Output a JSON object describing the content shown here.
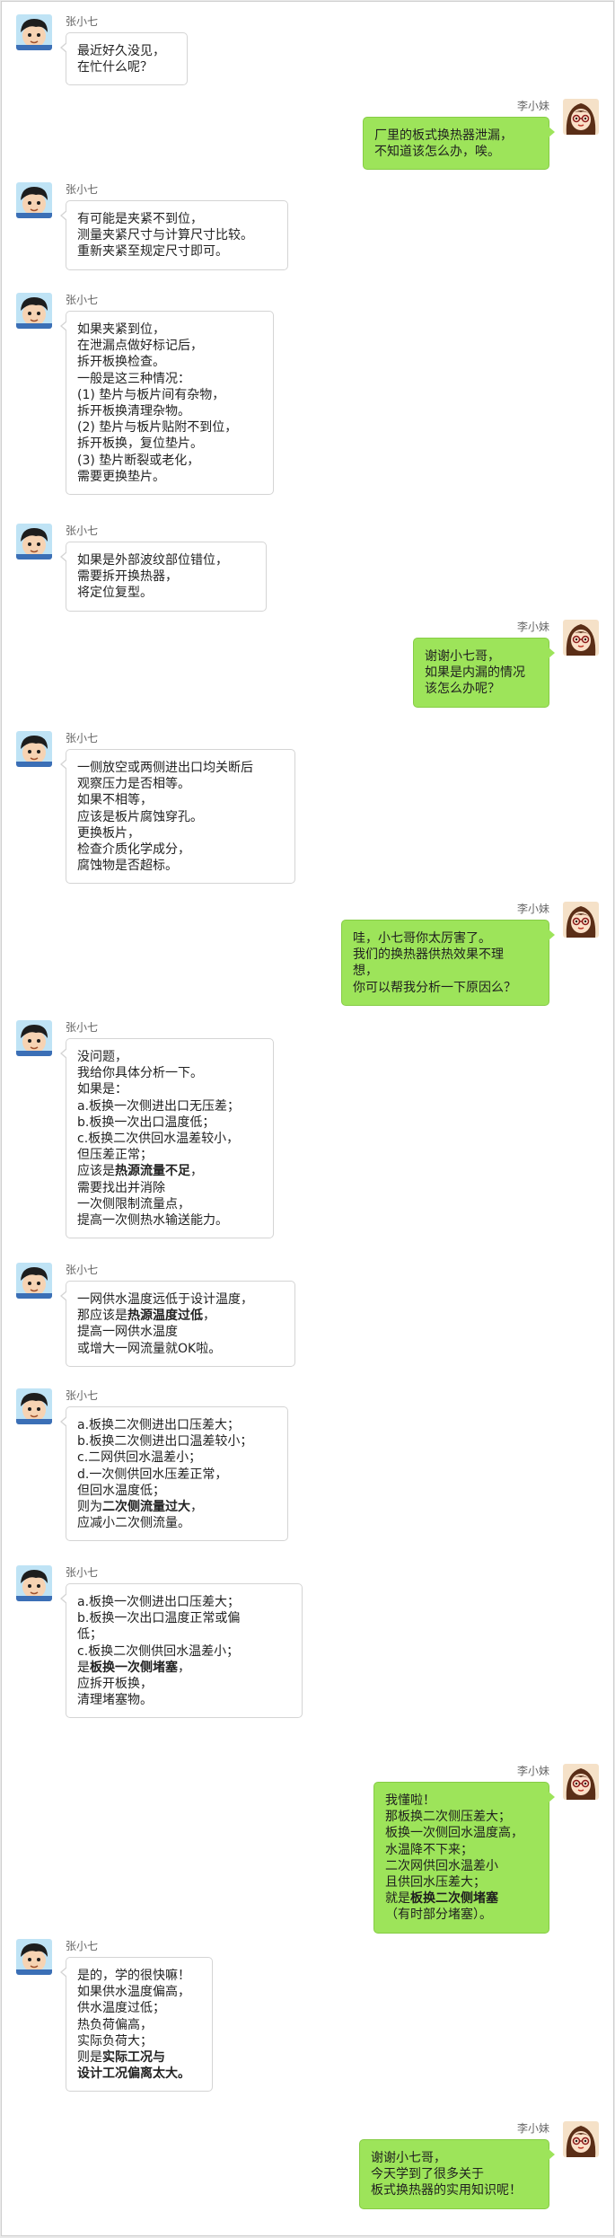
{
  "participants": {
    "left_name": "张小七",
    "right_name": "李小妹"
  },
  "colors": {
    "right_bubble": "#9de45a",
    "left_bubble": "#ffffff",
    "left_bubble_border": "#d4d4d4"
  },
  "messages": [
    {
      "side": "left",
      "name": "张小七",
      "lines": [
        [
          {
            "t": "最近好久没见，"
          }
        ],
        [
          {
            "t": "在忙什么呢？"
          }
        ]
      ]
    },
    {
      "side": "right",
      "name": "李小妹",
      "lines": [
        [
          {
            "t": "厂里的板式换热器泄漏，"
          }
        ],
        [
          {
            "t": "不知道该怎么办，唉。"
          }
        ]
      ]
    },
    {
      "side": "left",
      "name": "张小七",
      "lines": [
        [
          {
            "t": "有可能是夹紧不到位，"
          }
        ],
        [
          {
            "t": "测量夹紧尺寸与计算尺寸比较。"
          }
        ],
        [
          {
            "t": "重新夹紧至规定尺寸即可。"
          }
        ]
      ]
    },
    {
      "side": "left",
      "name": "张小七",
      "lines": [
        [
          {
            "t": "如果夹紧到位，"
          }
        ],
        [
          {
            "t": "在泄漏点做好标记后，"
          }
        ],
        [
          {
            "t": "拆开板换检查。"
          }
        ],
        [
          {
            "t": "一般是这三种情况："
          }
        ],
        [
          {
            "t": "(1) 垫片与板片间有杂物，"
          }
        ],
        [
          {
            "t": "拆开板换清理杂物。"
          }
        ],
        [
          {
            "t": "(2) 垫片与板片贴附不到位，"
          }
        ],
        [
          {
            "t": "拆开板换，复位垫片。"
          }
        ],
        [
          {
            "t": "(3) 垫片断裂或老化，"
          }
        ],
        [
          {
            "t": "需要更换垫片。"
          }
        ]
      ]
    },
    {
      "side": "left",
      "name": "张小七",
      "lines": [
        [
          {
            "t": "如果是外部波纹部位错位，"
          }
        ],
        [
          {
            "t": "需要拆开换热器，"
          }
        ],
        [
          {
            "t": "将定位复型。"
          }
        ]
      ]
    },
    {
      "side": "right",
      "name": "李小妹",
      "lines": [
        [
          {
            "t": "谢谢小七哥，"
          }
        ],
        [
          {
            "t": "如果是内漏的情况"
          }
        ],
        [
          {
            "t": "该怎么办呢？"
          }
        ]
      ]
    },
    {
      "side": "left",
      "name": "张小七",
      "lines": [
        [
          {
            "t": "一侧放空或两侧进出口均关断后"
          }
        ],
        [
          {
            "t": "观察压力是否相等。"
          }
        ],
        [
          {
            "t": "如果不相等，"
          }
        ],
        [
          {
            "t": "应该是板片腐蚀穿孔。"
          }
        ],
        [
          {
            "t": "更换板片，"
          }
        ],
        [
          {
            "t": "检查介质化学成分，"
          }
        ],
        [
          {
            "t": "腐蚀物是否超标。"
          }
        ]
      ]
    },
    {
      "side": "right",
      "name": "李小妹",
      "lines": [
        [
          {
            "t": "哇，小七哥你太厉害了。"
          }
        ],
        [
          {
            "t": "我们的换热器供热效果不理"
          }
        ],
        [
          {
            "t": "想，"
          }
        ],
        [
          {
            "t": "你可以帮我分析一下原因么？"
          }
        ]
      ]
    },
    {
      "side": "left",
      "name": "张小七",
      "lines": [
        [
          {
            "t": "没问题，"
          }
        ],
        [
          {
            "t": "我给你具体分析一下。"
          }
        ],
        [
          {
            "t": "如果是："
          }
        ],
        [
          {
            "t": "a.板换一次侧进出口无压差；"
          }
        ],
        [
          {
            "t": "b.板换一次出口温度低；"
          }
        ],
        [
          {
            "t": "c.板换二次供回水温差较小，"
          }
        ],
        [
          {
            "t": "但压差正常；"
          }
        ],
        [
          {
            "t": "应该是"
          },
          {
            "t": "热源流量不足",
            "b": true
          },
          {
            "t": "，"
          }
        ],
        [
          {
            "t": "需要找出并消除"
          }
        ],
        [
          {
            "t": "一次侧限制流量点，"
          }
        ],
        [
          {
            "t": "提高一次侧热水输送能力。"
          }
        ]
      ]
    },
    {
      "side": "left",
      "name": "张小七",
      "lines": [
        [
          {
            "t": "一网供水温度远低于设计温度，"
          }
        ],
        [
          {
            "t": "那应该是"
          },
          {
            "t": "热源温度过低",
            "b": true
          },
          {
            "t": "，"
          }
        ],
        [
          {
            "t": "提高一网供水温度"
          }
        ],
        [
          {
            "t": "或增大一网流量就OK啦。"
          }
        ]
      ]
    },
    {
      "side": "left",
      "name": "张小七",
      "lines": [
        [
          {
            "t": "a.板换二次侧进出口压差大；"
          }
        ],
        [
          {
            "t": "b.板换二次侧进出口温差较小；"
          }
        ],
        [
          {
            "t": "c.二网供回水温差小；"
          }
        ],
        [
          {
            "t": "d.一次侧供回水压差正常，"
          }
        ],
        [
          {
            "t": "但回水温度低；"
          }
        ],
        [
          {
            "t": "则为"
          },
          {
            "t": "二次侧流量过大",
            "b": true
          },
          {
            "t": "，"
          }
        ],
        [
          {
            "t": "应减小二次侧流量。"
          }
        ]
      ]
    },
    {
      "side": "left",
      "name": "张小七",
      "lines": [
        [
          {
            "t": "a.板换一次侧进出口压差大；"
          }
        ],
        [
          {
            "t": "b.板换一次出口温度正常或偏"
          }
        ],
        [
          {
            "t": "低；"
          }
        ],
        [
          {
            "t": "c.板换二次侧供回水温差小；"
          }
        ],
        [
          {
            "t": "是"
          },
          {
            "t": "板换一次侧堵塞",
            "b": true
          },
          {
            "t": "，"
          }
        ],
        [
          {
            "t": "应拆开板换，"
          }
        ],
        [
          {
            "t": "清理堵塞物。"
          }
        ]
      ]
    },
    {
      "side": "right",
      "name": "李小妹",
      "lines": [
        [
          {
            "t": "我懂啦！"
          }
        ],
        [
          {
            "t": "那板换二次侧压差大；"
          }
        ],
        [
          {
            "t": "板换一次侧回水温度高，"
          }
        ],
        [
          {
            "t": "水温降不下来；"
          }
        ],
        [
          {
            "t": "二次网供回水温差小"
          }
        ],
        [
          {
            "t": "且供回水压差大；"
          }
        ],
        [
          {
            "t": "就是"
          },
          {
            "t": "板换二次侧堵塞",
            "b": true
          }
        ],
        [
          {
            "t": "（有时部分堵塞）。"
          }
        ]
      ]
    },
    {
      "side": "left",
      "name": "张小七",
      "lines": [
        [
          {
            "t": "是的，学的很快嘛！"
          }
        ],
        [
          {
            "t": "如果供水温度偏高，"
          }
        ],
        [
          {
            "t": "供水温度过低；"
          }
        ],
        [
          {
            "t": "热负荷偏高，"
          }
        ],
        [
          {
            "t": "实际负荷大；"
          }
        ],
        [
          {
            "t": "则是"
          },
          {
            "t": "实际工况与",
            "b": true
          }
        ],
        [
          {
            "t": "设计工况偏离太大。",
            "b": true
          }
        ]
      ]
    },
    {
      "side": "right",
      "name": "李小妹",
      "lines": [
        [
          {
            "t": "谢谢小七哥，"
          }
        ],
        [
          {
            "t": "今天学到了很多关于"
          }
        ],
        [
          {
            "t": "板式换热器的实用知识呢！"
          }
        ]
      ]
    }
  ]
}
